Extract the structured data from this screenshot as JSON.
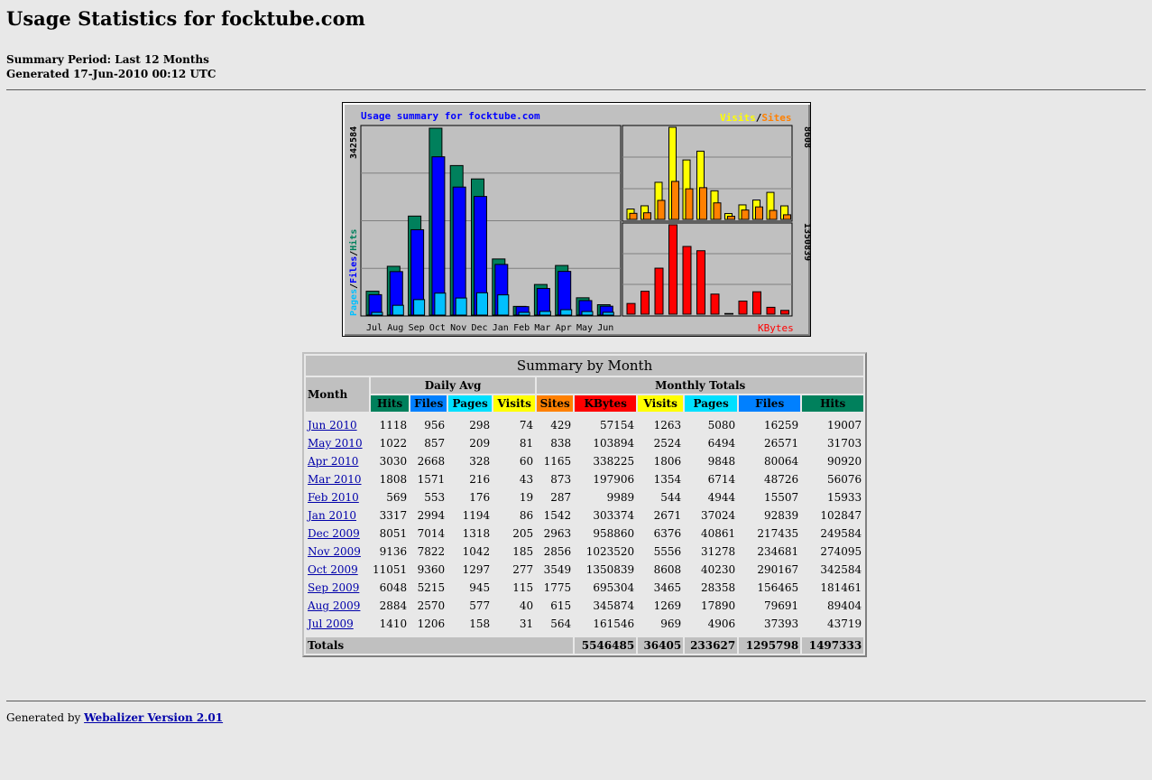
{
  "page": {
    "title": "Usage Statistics for focktube.com",
    "summary_period": "Summary Period: Last 12 Months",
    "generated": "Generated 17-Jun-2010 00:12 UTC"
  },
  "graph": {
    "title": "Usage summary for focktube.com",
    "legend_visits": "Visits",
    "legend_slash": "/",
    "legend_sites": "Sites",
    "left_axis_max": "342584",
    "left_legend_pages": "Pages",
    "left_legend_files": "Files",
    "left_legend_hits": "Hits",
    "right_top_max": "8608",
    "right_bottom_max": "1350839",
    "kbytes_label": "KBytes",
    "colors": {
      "hits": "#00805c",
      "files": "#0000ff",
      "pages": "#00c0ff",
      "visits": "#ffff00",
      "sites": "#ff8000",
      "kbytes": "#ff0000",
      "title": "#0000ff",
      "bg": "#c0c0c0"
    }
  },
  "chart_data": {
    "type": "bar",
    "title": "Usage summary for focktube.com",
    "categories": [
      "Jul",
      "Aug",
      "Sep",
      "Oct",
      "Nov",
      "Dec",
      "Jan",
      "Feb",
      "Mar",
      "Apr",
      "May",
      "Jun"
    ],
    "series": [
      {
        "name": "Hits",
        "values": [
          43719,
          89404,
          181461,
          342584,
          274095,
          249584,
          102847,
          15933,
          56076,
          90920,
          31703,
          19007
        ]
      },
      {
        "name": "Files",
        "values": [
          37393,
          79691,
          156465,
          290167,
          234681,
          217435,
          92839,
          15507,
          48726,
          80064,
          26571,
          16259
        ]
      },
      {
        "name": "Pages",
        "values": [
          4906,
          17890,
          28358,
          40230,
          31278,
          40861,
          37024,
          4944,
          6714,
          9848,
          6494,
          5080
        ]
      },
      {
        "name": "Visits",
        "values": [
          969,
          1269,
          3465,
          8608,
          5556,
          6376,
          2671,
          544,
          1354,
          1806,
          2524,
          1263
        ]
      },
      {
        "name": "Sites",
        "values": [
          564,
          615,
          1775,
          3549,
          2856,
          2963,
          1542,
          287,
          873,
          1165,
          838,
          429
        ]
      },
      {
        "name": "KBytes",
        "values": [
          161546,
          345874,
          695304,
          1350839,
          1023520,
          958860,
          303374,
          9989,
          197906,
          338225,
          103894,
          57154
        ]
      }
    ]
  },
  "table": {
    "title": "Summary by Month",
    "month_header": "Month",
    "daily_avg": "Daily Avg",
    "monthly_totals": "Monthly Totals",
    "col_headers": [
      "Hits",
      "Files",
      "Pages",
      "Visits",
      "Sites",
      "KBytes",
      "Visits",
      "Pages",
      "Files",
      "Hits"
    ],
    "rows": [
      {
        "month": "Jun 2010",
        "v": [
          "1118",
          "956",
          "298",
          "74",
          "429",
          "57154",
          "1263",
          "5080",
          "16259",
          "19007"
        ]
      },
      {
        "month": "May 2010",
        "v": [
          "1022",
          "857",
          "209",
          "81",
          "838",
          "103894",
          "2524",
          "6494",
          "26571",
          "31703"
        ]
      },
      {
        "month": "Apr 2010",
        "v": [
          "3030",
          "2668",
          "328",
          "60",
          "1165",
          "338225",
          "1806",
          "9848",
          "80064",
          "90920"
        ]
      },
      {
        "month": "Mar 2010",
        "v": [
          "1808",
          "1571",
          "216",
          "43",
          "873",
          "197906",
          "1354",
          "6714",
          "48726",
          "56076"
        ]
      },
      {
        "month": "Feb 2010",
        "v": [
          "569",
          "553",
          "176",
          "19",
          "287",
          "9989",
          "544",
          "4944",
          "15507",
          "15933"
        ]
      },
      {
        "month": "Jan 2010",
        "v": [
          "3317",
          "2994",
          "1194",
          "86",
          "1542",
          "303374",
          "2671",
          "37024",
          "92839",
          "102847"
        ]
      },
      {
        "month": "Dec 2009",
        "v": [
          "8051",
          "7014",
          "1318",
          "205",
          "2963",
          "958860",
          "6376",
          "40861",
          "217435",
          "249584"
        ]
      },
      {
        "month": "Nov 2009",
        "v": [
          "9136",
          "7822",
          "1042",
          "185",
          "2856",
          "1023520",
          "5556",
          "31278",
          "234681",
          "274095"
        ]
      },
      {
        "month": "Oct 2009",
        "v": [
          "11051",
          "9360",
          "1297",
          "277",
          "3549",
          "1350839",
          "8608",
          "40230",
          "290167",
          "342584"
        ]
      },
      {
        "month": "Sep 2009",
        "v": [
          "6048",
          "5215",
          "945",
          "115",
          "1775",
          "695304",
          "3465",
          "28358",
          "156465",
          "181461"
        ]
      },
      {
        "month": "Aug 2009",
        "v": [
          "2884",
          "2570",
          "577",
          "40",
          "615",
          "345874",
          "1269",
          "17890",
          "79691",
          "89404"
        ]
      },
      {
        "month": "Jul 2009",
        "v": [
          "1410",
          "1206",
          "158",
          "31",
          "564",
          "161546",
          "969",
          "4906",
          "37393",
          "43719"
        ]
      }
    ],
    "totals_label": "Totals",
    "totals": [
      "5546485",
      "36405",
      "233627",
      "1295798",
      "1497333"
    ]
  },
  "footer": {
    "generated_by": "Generated by ",
    "link_text": "Webalizer Version 2.01"
  }
}
